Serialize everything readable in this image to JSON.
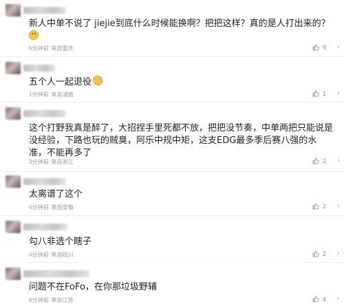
{
  "comments": [
    {
      "text": "新人中单不说了 jiejie到底什么时候能换啊？把把这样？真的是人打出来的？",
      "time": "6分钟前",
      "location": "来自重庆",
      "likes": "9"
    },
    {
      "text": "五个人一起退役",
      "time": "1分钟前",
      "location": "来自湖南",
      "likes": "1"
    },
    {
      "text": "这个打野我真是醉了，大招捏手里死都不放，把把没节奏，中单两把只能说是没经验，下路也玩的贼臭，阿乐中规中矩，这支EDG最多季后赛八强的水准，不能再多了",
      "time": "3分钟前",
      "location": "来自浙江",
      "likes": "2"
    },
    {
      "text": "太离谱了这个",
      "time": "4分钟前",
      "location": "来自安徽",
      "likes": "2"
    },
    {
      "text": "勾八非选个瞎子",
      "time": "4分钟前",
      "location": "来自四川",
      "likes": "2"
    },
    {
      "text": "问题不在FoFo，在你那垃圾野辅",
      "time": "6分钟前",
      "location": "来自江苏",
      "likes": "4"
    }
  ],
  "icons": {
    "like": "thumbs-up-icon",
    "more": "chevron-right-icon"
  }
}
